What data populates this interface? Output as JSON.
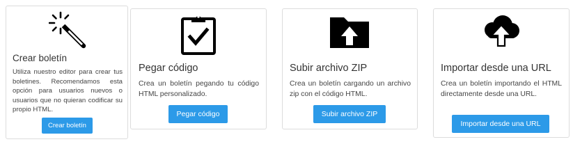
{
  "colors": {
    "accent": "#2c9ae8",
    "text": "#333333",
    "border": "#dcdcdc"
  },
  "cards": [
    {
      "icon": "magic-wand-icon",
      "title": "Crear boletín",
      "description": "Utiliza nuestro editor para crear tus boletines. Recomendamos esta opción para usuarios nuevos o usuarios que no quieran codificar su propio HTML.",
      "button": "Crear boletín"
    },
    {
      "icon": "clipboard-check-icon",
      "title": "Pegar código",
      "description": "Crea un boletín pegando tu código HTML personalizado.",
      "button": "Pegar código"
    },
    {
      "icon": "folder-upload-icon",
      "title": "Subir archivo ZIP",
      "description": "Crea un boletín cargando un archivo zip con el código HTML.",
      "button": "Subir archivo ZIP"
    },
    {
      "icon": "cloud-upload-icon",
      "title": "Importar desde una URL",
      "description": "Crea un boletín importando el HTML directamente desde una URL.",
      "button": "Importar desde una URL"
    }
  ]
}
